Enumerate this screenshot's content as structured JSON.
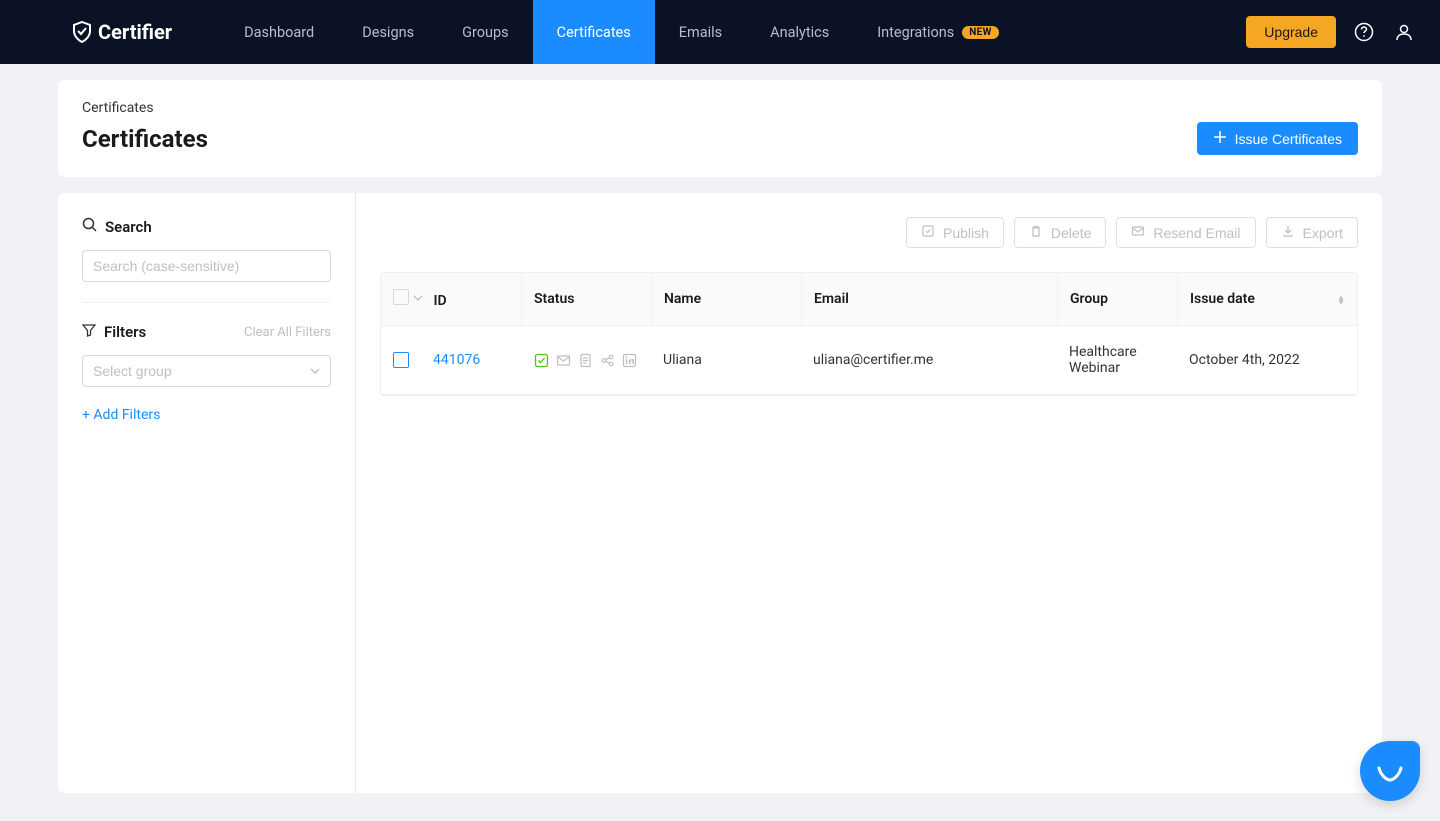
{
  "brand": {
    "name": "Certifier"
  },
  "nav": {
    "items": [
      {
        "label": "Dashboard",
        "active": false
      },
      {
        "label": "Designs",
        "active": false
      },
      {
        "label": "Groups",
        "active": false
      },
      {
        "label": "Certificates",
        "active": true
      },
      {
        "label": "Emails",
        "active": false
      },
      {
        "label": "Analytics",
        "active": false
      },
      {
        "label": "Integrations",
        "active": false,
        "badge": "NEW"
      }
    ],
    "upgrade_label": "Upgrade"
  },
  "header": {
    "breadcrumb": "Certificates",
    "title": "Certificates",
    "primary_button": "Issue Certificates"
  },
  "sidebar": {
    "search_heading": "Search",
    "search_placeholder": "Search (case-sensitive)",
    "filters_heading": "Filters",
    "clear_label": "Clear All Filters",
    "group_placeholder": "Select group",
    "add_filters_label": "+ Add Filters"
  },
  "actions": {
    "publish": "Publish",
    "delete": "Delete",
    "resend": "Resend Email",
    "export": "Export"
  },
  "table": {
    "columns": {
      "id": "ID",
      "status": "Status",
      "name": "Name",
      "email": "Email",
      "group": "Group",
      "issue_date": "Issue date"
    },
    "rows": [
      {
        "id": "441076",
        "name": "Uliana",
        "email": "uliana@certifier.me",
        "group": "Healthcare Webinar",
        "issue_date": "October 4th, 2022"
      }
    ]
  }
}
